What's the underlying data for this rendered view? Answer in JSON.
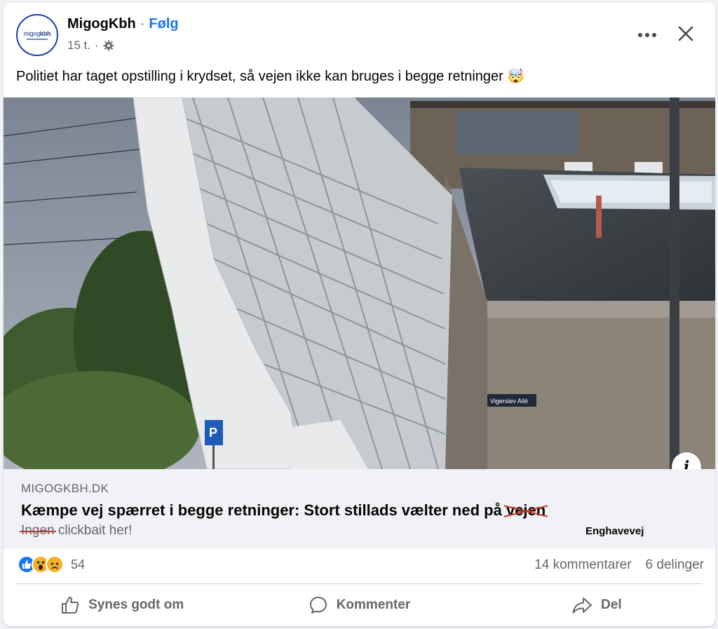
{
  "post": {
    "page_name": "MigogKbh",
    "follow_label": "Følg",
    "time": "15 t.",
    "avatar_text_light": "migog",
    "avatar_text_bold": "kbh",
    "text": "Politiet har taget opstilling i krydset, så vejen ikke kan bruges i begge retninger",
    "emoji": "🤯"
  },
  "photo": {
    "sign_parking": "P",
    "street_sign": "Vigerslev Allé"
  },
  "link": {
    "domain": "MIGOGKBH.DK",
    "headline_main": "Kæmpe vej spærret i begge retninger: Stort stillads vælter ned på ",
    "headline_struck": "vejen",
    "replacement": "Enghavevej",
    "sub_struck": "Ingen",
    "sub_rest": " clickbait her!"
  },
  "stats": {
    "reaction_count": "54",
    "comments": "14 kommentarer",
    "shares": "6 delinger"
  },
  "actions": {
    "like": "Synes godt om",
    "comment": "Kommenter",
    "share": "Del"
  },
  "colors": {
    "accent": "#1877f2",
    "muted": "#65676b",
    "preview_bg": "#f0f2f5",
    "strike": "#c0392b"
  },
  "icons": [
    "gear-icon",
    "more-icon",
    "close-icon",
    "info-icon",
    "like-reaction-icon",
    "wow-reaction-icon",
    "sad-reaction-icon",
    "thumbs-up-icon",
    "comment-icon",
    "share-icon"
  ]
}
